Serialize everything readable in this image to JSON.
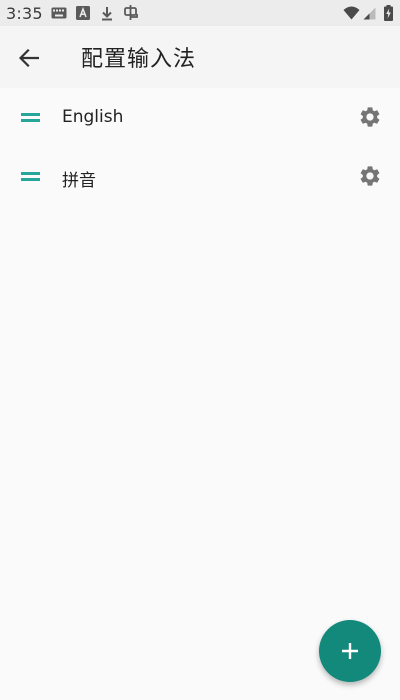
{
  "status_bar": {
    "time": "3:35",
    "icons": [
      "keyboard-icon",
      "font-a-icon",
      "download-icon",
      "debug-icon",
      "wifi-icon",
      "signal-icon",
      "battery-charging-icon"
    ]
  },
  "toolbar": {
    "title": "配置输入法",
    "back_icon": "arrow-back-icon"
  },
  "input_methods": [
    {
      "label": "English",
      "handle_icon": "drag-handle-icon",
      "settings_icon": "gear-icon"
    },
    {
      "label": "拼音",
      "handle_icon": "drag-handle-icon",
      "settings_icon": "gear-icon"
    }
  ],
  "fab": {
    "icon": "plus-icon"
  },
  "colors": {
    "accent": "#12897b",
    "handle": "#26a69a",
    "background": "#fafafa"
  }
}
